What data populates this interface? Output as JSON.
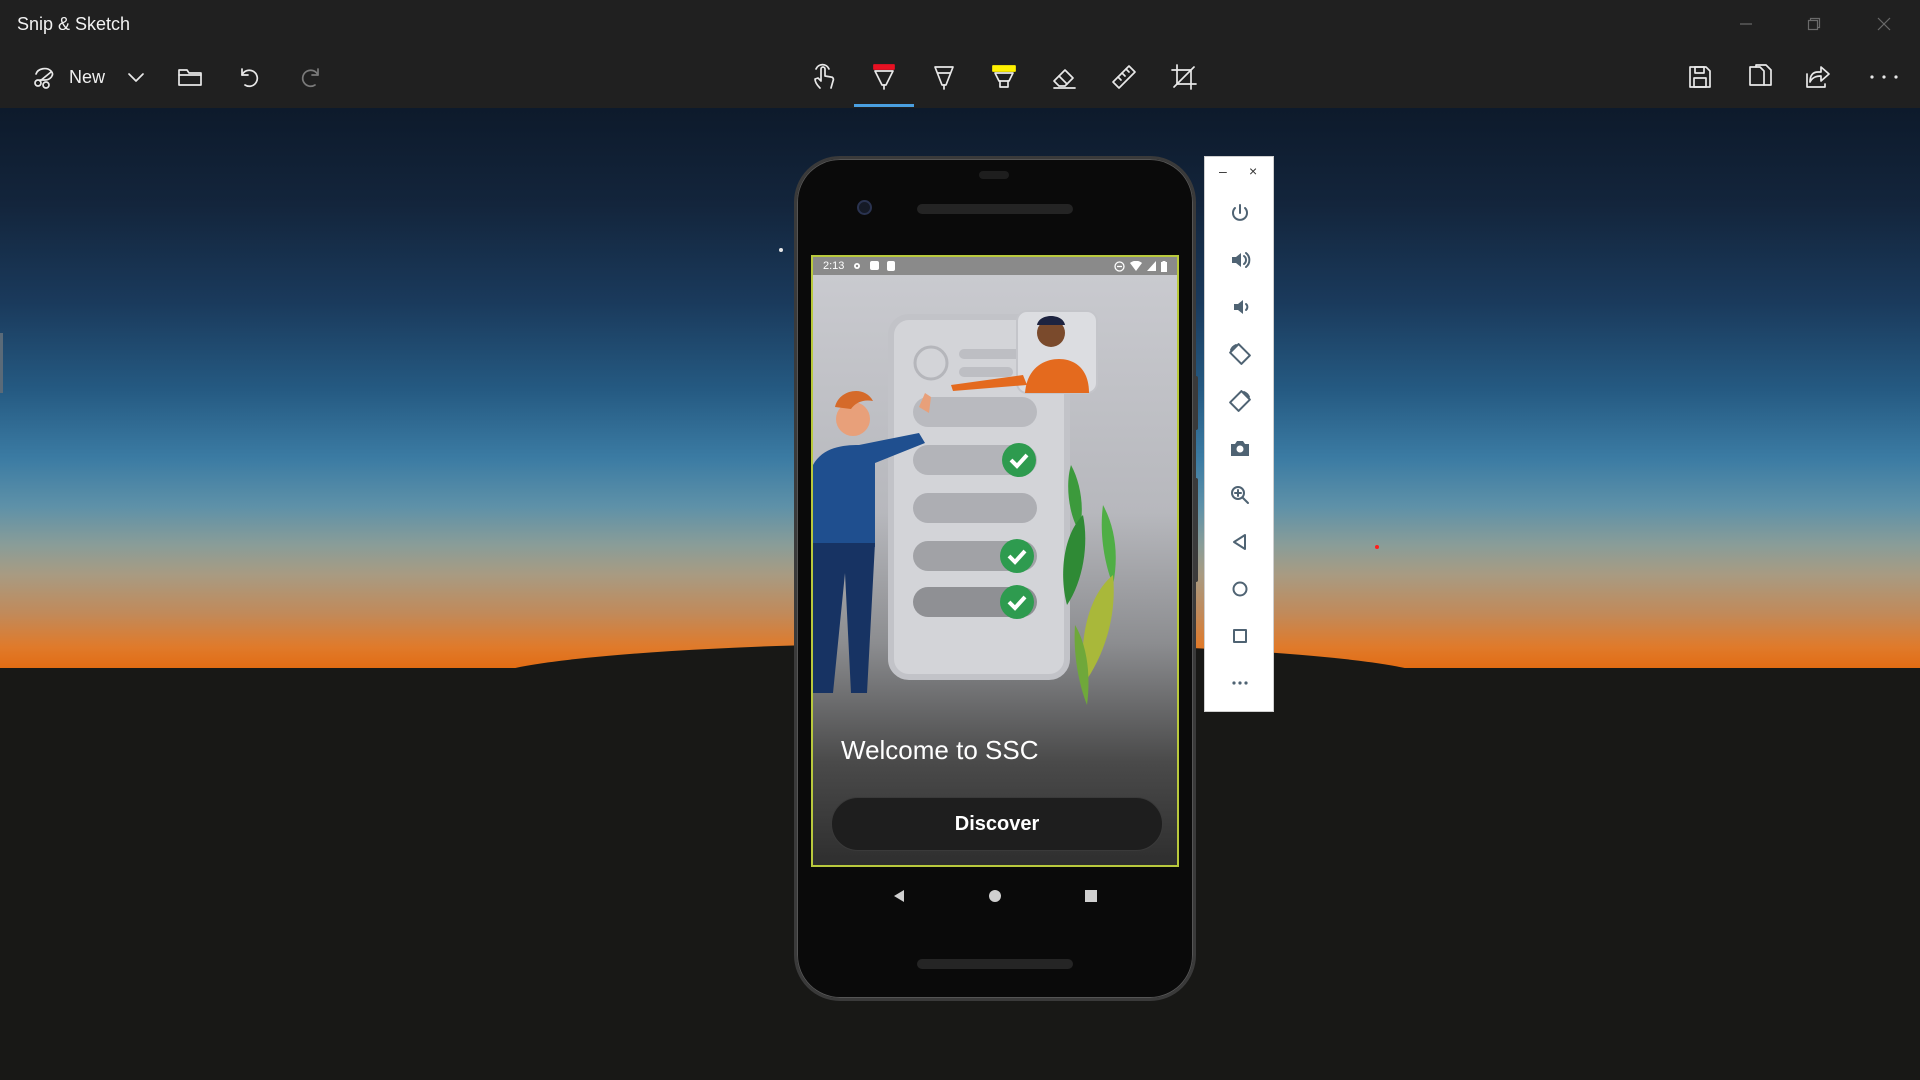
{
  "window": {
    "title": "Snip & Sketch",
    "controls": [
      "minimize",
      "restore",
      "close"
    ]
  },
  "toolbar": {
    "new_label": "New",
    "left_tools": [
      {
        "name": "new-snip-icon"
      },
      {
        "name": "chevron-down-icon"
      },
      {
        "name": "open-folder-icon"
      },
      {
        "name": "undo-icon"
      },
      {
        "name": "redo-icon"
      }
    ],
    "center_tools": [
      {
        "name": "touch-writing-icon"
      },
      {
        "name": "ballpoint-pen-icon",
        "active": true
      },
      {
        "name": "pencil-icon"
      },
      {
        "name": "highlighter-icon"
      },
      {
        "name": "eraser-icon"
      },
      {
        "name": "ruler-icon"
      },
      {
        "name": "crop-icon"
      }
    ],
    "right_tools": [
      {
        "name": "save-icon"
      },
      {
        "name": "copy-icon"
      },
      {
        "name": "share-icon"
      },
      {
        "name": "more-icon"
      }
    ],
    "accent_color": "#4a9fe0"
  },
  "phone": {
    "status_time": "2:13",
    "welcome_text": "Welcome to SSC",
    "discover_label": "Discover",
    "nav": [
      "back-icon",
      "home-icon",
      "recents-icon"
    ]
  },
  "emulator_panel": {
    "header": [
      "–",
      "×"
    ],
    "buttons": [
      "power-icon",
      "volume-up-icon",
      "volume-down-icon",
      "rotate-left-icon",
      "rotate-right-icon",
      "screenshot-camera-icon",
      "zoom-icon",
      "back-icon",
      "home-icon",
      "overview-icon",
      "more-icon"
    ]
  }
}
